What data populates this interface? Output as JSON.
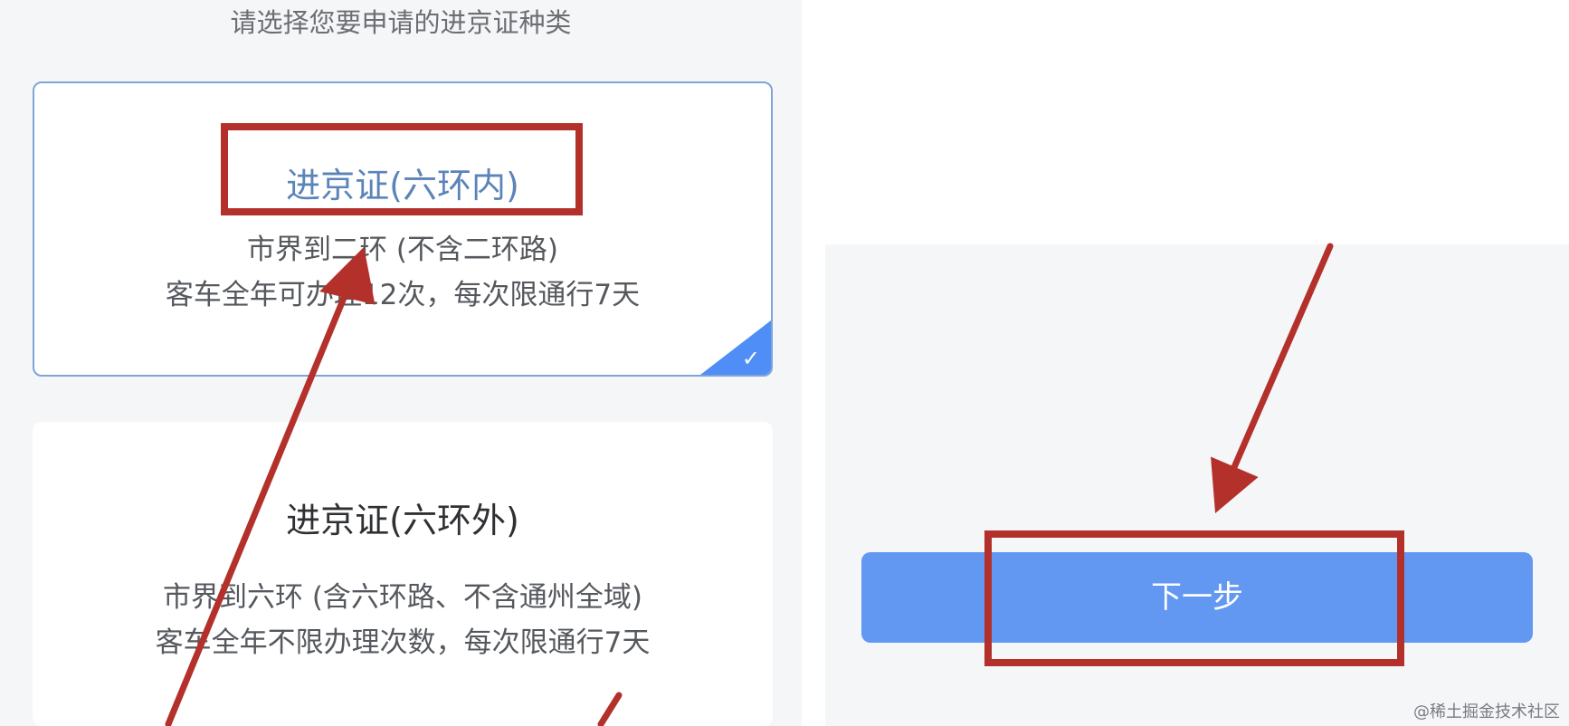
{
  "left": {
    "prompt": "请选择您要申请的进京证种类",
    "card_inner": {
      "title": "进京证(六环内)",
      "line1": "市界到二环 (不含二环路)",
      "line2": "客车全年可办理12次，每次限通行7天",
      "selected": true
    },
    "card_outer": {
      "title": "进京证(六环外)",
      "line1": "市界到六环 (含六环路、不含通州全域)",
      "line2": "客车全年不限办理次数，每次限通行7天"
    }
  },
  "right": {
    "next_label": "下一步"
  },
  "watermark": "@稀土掘金技术社区",
  "colors": {
    "annotation_red": "#b3302b",
    "accent_blue": "#4f8ef7",
    "button_blue": "#6398f2"
  }
}
